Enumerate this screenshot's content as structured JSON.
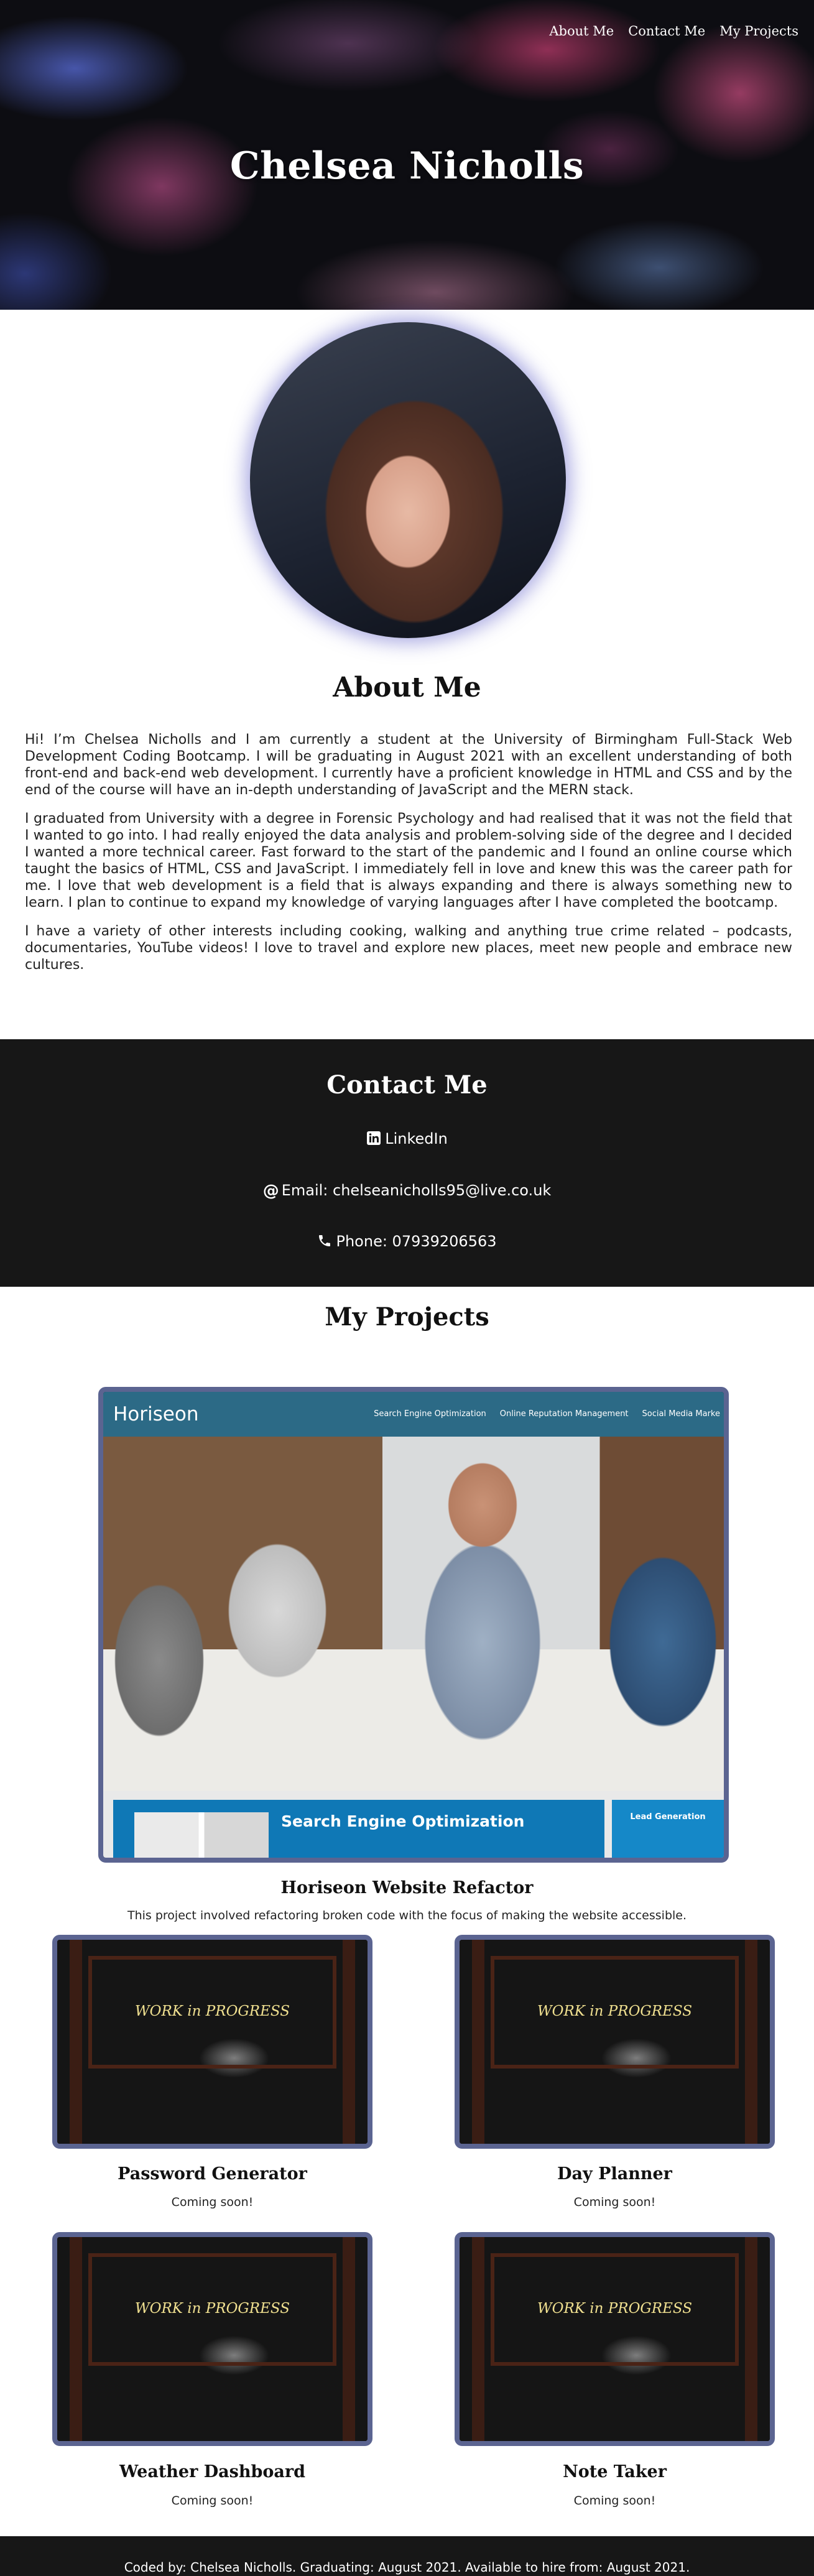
{
  "hero": {
    "nav": [
      "About Me",
      "Contact Me",
      "My Projects"
    ],
    "title": "Chelsea Nicholls"
  },
  "about": {
    "title": "About Me",
    "paragraphs": [
      "Hi! I’m Chelsea Nicholls and I am currently a student at the University of Birmingham Full-Stack Web Development Coding Bootcamp. I will be graduating in August 2021 with an excellent understanding of both front-end and back-end web development. I currently have a proficient knowledge in HTML and CSS and by the end of the course will have an in-depth understanding of JavaScript and the MERN stack.",
      "I graduated from University with a degree in Forensic Psychology and had realised that it was not the field that I wanted to go into. I had really enjoyed the data analysis and problem-solving side of the degree and I decided I wanted a more technical career. Fast forward to the start of the pandemic and I found an online course which taught the basics of HTML, CSS and JavaScript. I immediately fell in love and knew this was the career path for me. I love that web development is a field that is always expanding and there is always something new to learn. I plan to continue to expand my knowledge of varying languages after I have completed the bootcamp.",
      "I have a variety of other interests including cooking, walking and anything true crime related – podcasts, documentaries, YouTube videos! I love to travel and explore new places, meet new people and embrace new cultures."
    ]
  },
  "contact": {
    "title": "Contact Me",
    "linkedin": "LinkedIn",
    "email": "Email: chelseanicholls95@live.co.uk",
    "phone": "Phone: 07939206563"
  },
  "projects": {
    "title": "My Projects",
    "featured": {
      "name": "Horiseon Website Refactor",
      "description": "This project involved refactoring broken code with the focus of making the website accessible.",
      "screenshot": {
        "logo": "Horiseon",
        "nav": [
          "Search Engine Optimization",
          "Online Reputation Management",
          "Social Media Marke"
        ],
        "seo_heading": "Search Engine Optimization",
        "lead_heading": "Lead Generation"
      }
    },
    "items": [
      {
        "name": "Password Generator",
        "description": "Coming soon!",
        "image_text": "WORK in PROGRESS"
      },
      {
        "name": "Day Planner",
        "description": "Coming soon!",
        "image_text": "WORK in PROGRESS"
      },
      {
        "name": "Weather Dashboard",
        "description": "Coming soon!",
        "image_text": "WORK in PROGRESS"
      },
      {
        "name": "Note Taker",
        "description": "Coming soon!",
        "image_text": "WORK in PROGRESS"
      }
    ]
  },
  "footer": {
    "text": "Coded by: Chelsea Nicholls. Graduating: August 2021. Available to hire from: August 2021."
  }
}
